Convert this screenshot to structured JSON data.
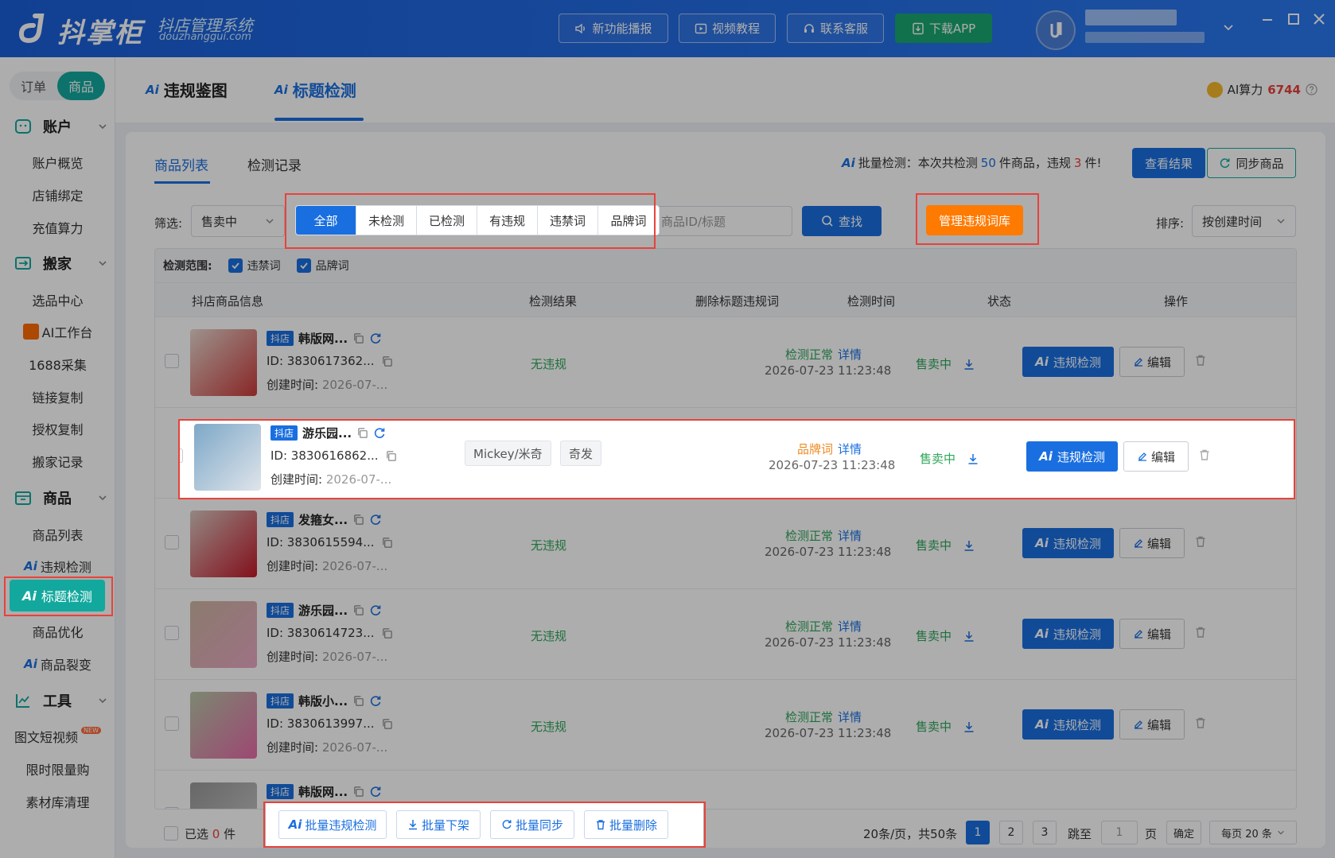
{
  "app": {
    "logo_text": "抖掌柜",
    "logo_subtitle": "抖店管理系统",
    "logo_url": "douzhanggui.com",
    "top_buttons": {
      "new_features": "新功能播报",
      "video_tutorial": "视频教程",
      "contact": "联系客服",
      "download": "下载APP"
    }
  },
  "sidebar": {
    "mode_order": "订单",
    "mode_goods": "商品",
    "groups": {
      "account": "账户",
      "move": "搬家",
      "goods": "商品",
      "tools": "工具"
    },
    "items": {
      "account_overview": "账户概览",
      "store_bind": "店铺绑定",
      "recharge": "充值算力",
      "selection": "选品中心",
      "ai_workbench": "AI工作台",
      "collect_1688": "1688采集",
      "link_copy": "链接复制",
      "auth_copy": "授权复制",
      "move_record": "搬家记录",
      "goods_list": "商品列表",
      "violation_check": "违规检测",
      "title_check": "标题检测",
      "goods_optimize": "商品优化",
      "goods_split": "商品裂变",
      "short_video": "图文短视频",
      "new_badge": "NEW",
      "flash_sale": "限时限量购",
      "material_clean": "素材库清理"
    },
    "ai_tag": "Ai"
  },
  "main_tabs": {
    "violation_image": "违规鉴图",
    "title_check": "标题检测",
    "ai_tag": "Ai"
  },
  "ai_power": {
    "label": "AI算力",
    "value": "6744"
  },
  "subtabs": {
    "goods_list": "商品列表",
    "check_record": "检测记录"
  },
  "batch_info": {
    "prefix": "批量检测：本次共检测",
    "count": "50",
    "mid": "件商品，违规",
    "violations": "3",
    "suffix": "件!"
  },
  "buttons": {
    "view_results": "查看结果",
    "sync_goods": "同步商品",
    "search": "查找",
    "manage_lexicon": "管理违规词库"
  },
  "filter": {
    "label": "筛选:",
    "status_value": "售卖中",
    "segments": [
      "全部",
      "未检测",
      "已检测",
      "有违规",
      "违禁词",
      "品牌词"
    ],
    "search_placeholder": "商品ID/标题",
    "sort_label": "排序:",
    "sort_value": "按创建时间"
  },
  "scope": {
    "label": "检测范围:",
    "forbidden": "违禁词",
    "brand": "品牌词"
  },
  "columns": {
    "info": "抖店商品信息",
    "result": "检测结果",
    "delete_words": "删除标题违规词",
    "time": "检测时间",
    "status": "状态",
    "ops": "操作"
  },
  "row_common": {
    "shop_tag": "抖店",
    "created_prefix": "创建时间:",
    "created_value": "2026-07-...",
    "detail": "详情",
    "check_btn": "违规检测",
    "edit_btn": "编辑",
    "time": "2026-07-23 11:23:48",
    "on_sale": "售卖中"
  },
  "rows": [
    {
      "title": "韩版网...",
      "id": "ID: 3830617362...",
      "result": "无违规",
      "check_status": "检测正常"
    },
    {
      "title": "游乐园...",
      "id": "ID: 3830616862...",
      "keywords": [
        "Mickey/米奇",
        "奇发"
      ],
      "check_status": "品牌词"
    },
    {
      "title": "发箍女...",
      "id": "ID: 3830615594...",
      "result": "无违规",
      "check_status": "检测正常"
    },
    {
      "title": "游乐园...",
      "id": "ID: 3830614723...",
      "result": "无违规",
      "check_status": "检测正常"
    },
    {
      "title": "韩版小...",
      "id": "ID: 3830613997...",
      "result": "无违规",
      "check_status": "检测正常"
    },
    {
      "title": "韩版网..."
    }
  ],
  "footer": {
    "selected_prefix": "已选",
    "selected_count": "0",
    "selected_suffix": "件",
    "batch_check": "批量违规检测",
    "batch_off": "批量下架",
    "batch_sync": "批量同步",
    "batch_delete": "批量删除",
    "page_summary": "20条/页，共50条",
    "pages": [
      "1",
      "2",
      "3"
    ],
    "jump_label": "跳至",
    "jump_value": "1",
    "page_unit": "页",
    "confirm": "确定",
    "page_size": "每页 20 条"
  }
}
